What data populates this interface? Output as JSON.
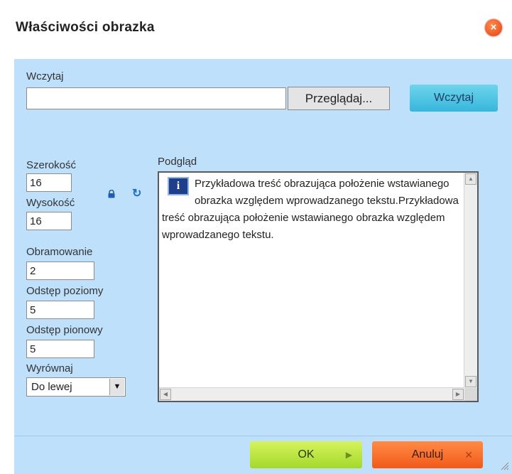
{
  "dialog": {
    "title": "Właściwości obrazka"
  },
  "upload": {
    "label": "Wczytaj",
    "file_value": "",
    "browse_label": "Przeglądaj...",
    "load_label": "Wczytaj"
  },
  "size": {
    "width_label": "Szerokość",
    "width_value": "16",
    "height_label": "Wysokość",
    "height_value": "16"
  },
  "border": {
    "label": "Obramowanie",
    "value": "2"
  },
  "hspace": {
    "label": "Odstęp poziomy",
    "value": "5"
  },
  "vspace": {
    "label": "Odstęp pionowy",
    "value": "5"
  },
  "align": {
    "label": "Wyrównaj",
    "value": "Do lewej"
  },
  "preview": {
    "label": "Podgląd",
    "text": "Przykładowa treść obrazująca położenie wstawianego obrazka względem wprowadzanego tekstu.Przykładowa treść obrazująca położenie wstawianego obrazka względem wprowadzanego tekstu.",
    "icon_letter": "i"
  },
  "footer": {
    "ok_label": "OK",
    "cancel_label": "Anuluj"
  },
  "colors": {
    "body_bg": "#bfe0fb",
    "load_button": "#36b6dc",
    "ok_button": "#a4d92c",
    "cancel_button": "#f15a1a",
    "close_button": "#e2420f"
  }
}
